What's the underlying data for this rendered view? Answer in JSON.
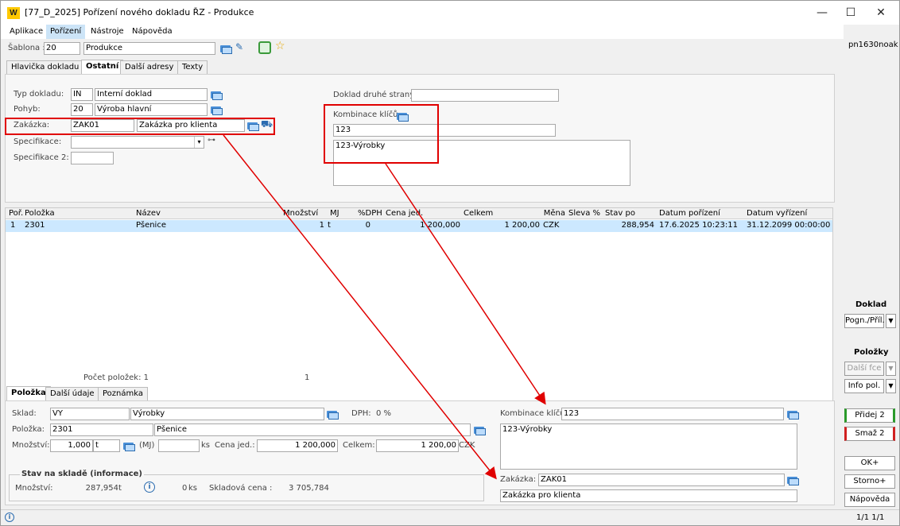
{
  "window": {
    "title": "[77_D_2025] Pořízení nového dokladu ŘZ - Produkce",
    "app_icon": "W",
    "minimize": "—",
    "maximize": "☐",
    "close": "✕"
  },
  "menu": [
    "Aplikace",
    "Pořízení",
    "Nástroje",
    "Nápověda"
  ],
  "user": "pn1630noak",
  "template": {
    "label": "Šablona :",
    "code": "20",
    "name": "Produkce"
  },
  "tabs": [
    "Hlavička dokladu",
    "Ostatní",
    "Další adresy",
    "Texty"
  ],
  "header": {
    "doc_type": {
      "label": "Typ dokladu:",
      "code": "IN",
      "name": "Interní doklad"
    },
    "movement": {
      "label": "Pohyb:",
      "code": "20",
      "name": "Výroba hlavní"
    },
    "order": {
      "label": "Zakázka:",
      "code": "ZAK01",
      "name": "Zakázka pro klienta"
    },
    "spec": {
      "label": "Specifikace:",
      "value": ""
    },
    "spec2": {
      "label": "Specifikace 2:",
      "value": ""
    },
    "other_doc": {
      "label": "Doklad druhé strany:",
      "value": ""
    },
    "key_combo": {
      "label": "Kombinace klíčů:",
      "value": "123",
      "desc": "123-Výrobky"
    }
  },
  "grid": {
    "columns": [
      "Poř.",
      "Položka",
      "Název",
      "Množství",
      "MJ",
      "%DPH",
      "Cena jed.",
      "Celkem",
      "Měna",
      "Sleva %",
      "Stav po",
      "Datum pořízení",
      "Datum vyřízení"
    ],
    "rows": [
      [
        "1",
        "2301",
        "Pšenice",
        "1",
        "t",
        "0",
        "1 200,000",
        "1 200,00",
        "CZK",
        "",
        "288,954",
        "17.6.2025 10:23:11",
        "31.12.2099 00:00:00"
      ]
    ],
    "footer_label": "Počet položek: 1",
    "footer_sum": "1"
  },
  "item_tabs": [
    "Položka",
    "Další údaje",
    "Poznámka"
  ],
  "item": {
    "store": {
      "label": "Sklad:",
      "code": "VY",
      "name": "Výrobky"
    },
    "vat": {
      "label": "DPH:",
      "value": "0 %"
    },
    "product": {
      "label": "Položka:",
      "code": "2301",
      "name": "Pšenice"
    },
    "qty": {
      "label": "Množství:",
      "value": "1,000",
      "unit": "t",
      "mj": "(MJ)",
      "ks": "ks"
    },
    "unit_price": {
      "label": "Cena jed.:",
      "value": "1 200,000"
    },
    "total": {
      "label": "Celkem:",
      "value": "1 200,00",
      "currency": "CZK"
    },
    "key_combo": {
      "label": "Kombinace klíčů:",
      "value": "123",
      "desc": "123-Výrobky"
    },
    "order": {
      "label": "Zakázka:",
      "code": "ZAK01",
      "name": "Zakázka pro klienta"
    }
  },
  "stock": {
    "title": "Stav na skladě (informace)",
    "qty_label": "Množství:",
    "qty": "287,954",
    "unit": "t",
    "zero": "0",
    "ks": "ks",
    "price_label": "Skladová cena :",
    "price": "3 705,784"
  },
  "side": {
    "doc_title": "Doklad",
    "attach": "Pogn./Příl.",
    "items_title": "Položky",
    "more": "Další fce",
    "info": "Info pol.",
    "add": "Přidej 2",
    "delete": "Smaž 2",
    "ok": "OK+",
    "storno": "Storno+",
    "help": "Nápověda"
  },
  "status": {
    "pages": "1/1  1/1"
  },
  "colors": {
    "highlight_row": "#cce8ff",
    "annotation": "#e00000",
    "accent": "#ffc800"
  }
}
